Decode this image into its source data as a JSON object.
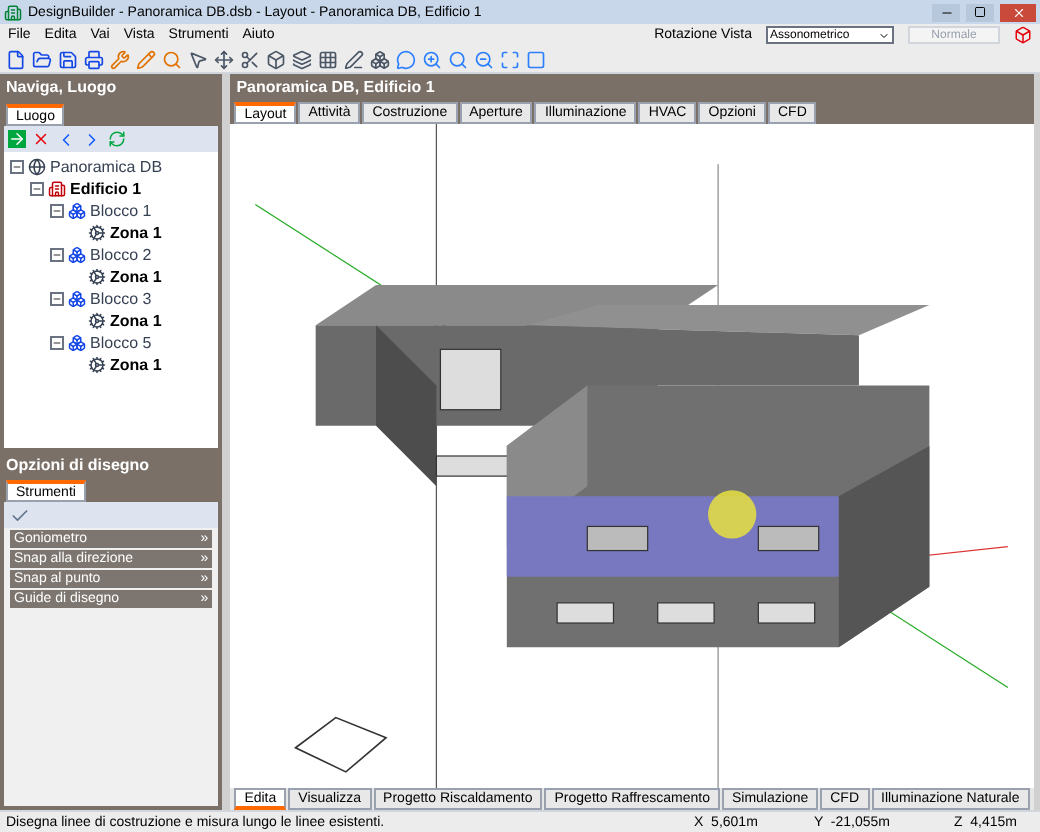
{
  "window": {
    "title": "DesignBuilder - Panoramica DB.dsb - Layout - Panoramica DB, Edificio 1"
  },
  "menu": [
    "File",
    "Edita",
    "Vai",
    "Vista",
    "Strumenti",
    "Aiuto"
  ],
  "view_rotation": {
    "label": "Rotazione Vista",
    "value": "Assonometrico",
    "mode": "Normale",
    "mode_disabled": true
  },
  "navigation": {
    "title": "Naviga, Luogo",
    "tabs": [
      {
        "label": "Luogo",
        "selected": true
      }
    ],
    "tree": [
      {
        "label": "Panoramica DB",
        "bold": false,
        "expanded": true,
        "kind": "site",
        "children": [
          {
            "label": "Edificio 1",
            "bold": true,
            "expanded": true,
            "kind": "building",
            "children": [
              {
                "label": "Blocco 1",
                "bold": false,
                "expanded": true,
                "kind": "block",
                "children": [
                  {
                    "label": "Zona 1",
                    "bold": true,
                    "kind": "zone"
                  }
                ]
              },
              {
                "label": "Blocco 2",
                "bold": false,
                "expanded": true,
                "kind": "block",
                "children": [
                  {
                    "label": "Zona 1",
                    "bold": true,
                    "kind": "zone"
                  }
                ]
              },
              {
                "label": "Blocco 3",
                "bold": false,
                "expanded": true,
                "kind": "block",
                "children": [
                  {
                    "label": "Zona 1",
                    "bold": true,
                    "kind": "zone"
                  }
                ]
              },
              {
                "label": "Blocco 5",
                "bold": false,
                "expanded": true,
                "kind": "block",
                "children": [
                  {
                    "label": "Zona 1",
                    "bold": true,
                    "kind": "zone"
                  }
                ]
              }
            ]
          }
        ]
      }
    ]
  },
  "drawing_options": {
    "title": "Opzioni di disegno",
    "tabs": [
      {
        "label": "Strumenti",
        "selected": true
      }
    ],
    "sections": [
      {
        "label": "Goniometro",
        "symbol": "»"
      },
      {
        "label": "Snap alla direzione",
        "symbol": "»"
      },
      {
        "label": "Snap al punto",
        "symbol": "»"
      },
      {
        "label": "Guide di disegno",
        "symbol": "»"
      }
    ]
  },
  "viewport": {
    "title": "Panoramica DB, Edificio 1",
    "tabs": [
      {
        "label": "Layout",
        "selected": true
      },
      {
        "label": "Attività",
        "selected": false
      },
      {
        "label": "Costruzione",
        "selected": false
      },
      {
        "label": "Aperture",
        "selected": false
      },
      {
        "label": "Illuminazione",
        "selected": false
      },
      {
        "label": "HVAC",
        "selected": false
      },
      {
        "label": "Opzioni",
        "selected": false
      },
      {
        "label": "CFD",
        "selected": false
      }
    ],
    "bottom_tabs": [
      {
        "label": "Edita",
        "selected": true
      },
      {
        "label": "Visualizza",
        "selected": false
      },
      {
        "label": "Progetto Riscaldamento",
        "selected": false
      },
      {
        "label": "Progetto Raffrescamento",
        "selected": false
      },
      {
        "label": "Simulazione",
        "selected": false
      },
      {
        "label": "CFD",
        "selected": false
      },
      {
        "label": "Illuminazione Naturale",
        "selected": false
      }
    ]
  },
  "status_bar": {
    "message": "Disegna linee di costruzione e misura lungo le linee esistenti.",
    "x": "X  5,601m",
    "y": "Y  -21,055m",
    "z": "Z  4,415m"
  }
}
